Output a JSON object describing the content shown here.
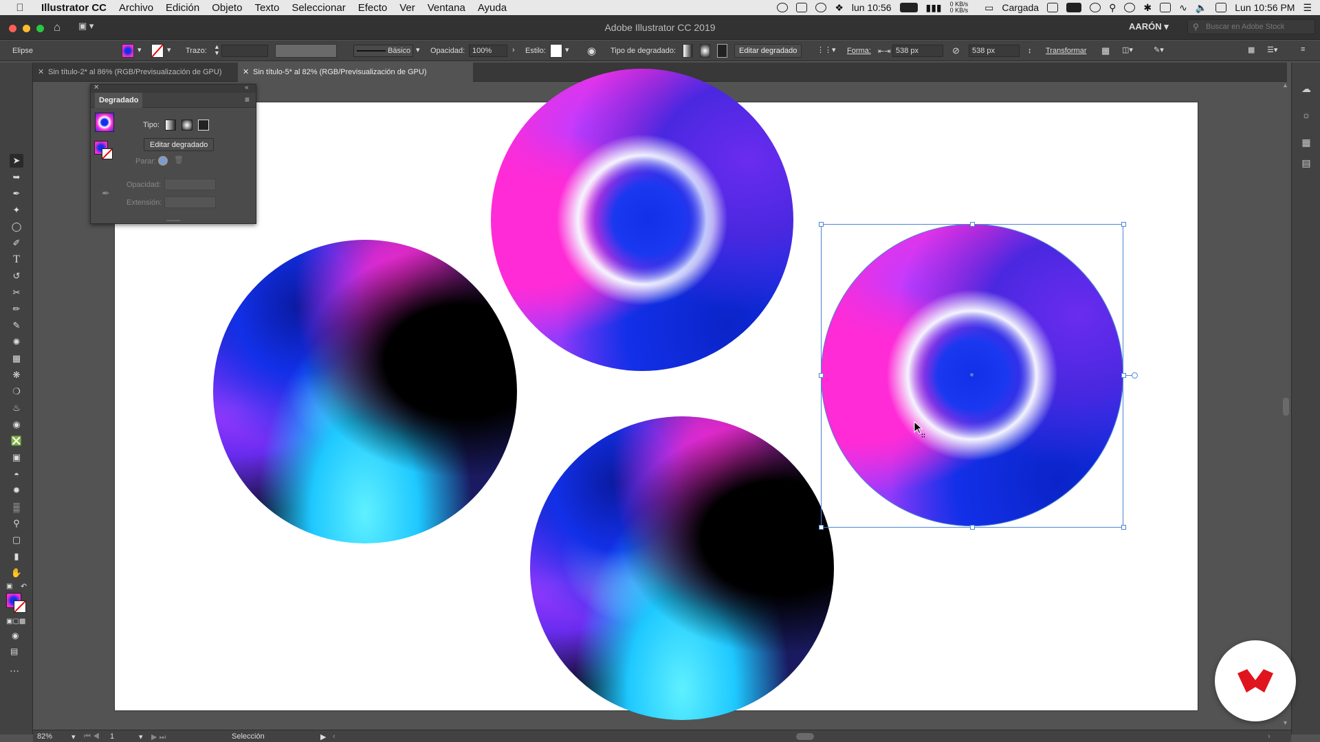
{
  "menubar": {
    "apple_icon": "apple-icon",
    "app_name": "Illustrator CC",
    "items": [
      "Archivo",
      "Edición",
      "Objeto",
      "Texto",
      "Seleccionar",
      "Efecto",
      "Ver",
      "Ventana",
      "Ayuda"
    ],
    "date_short": "lun 10:56",
    "net_up": "0 KB/s",
    "net_down": "0 KB/s",
    "battery": "Cargada",
    "clock": "Lun 10:56 PM"
  },
  "window": {
    "title": "Adobe Illustrator CC 2019",
    "user": "AARÓN",
    "stock_placeholder": "Buscar en Adobe Stock"
  },
  "control": {
    "object_type": "Elipse",
    "stroke_label": "Trazo:",
    "brush_label": "Básico",
    "opacity_label": "Opacidad:",
    "opacity_value": "100%",
    "style_label": "Estilo:",
    "gradient_type_label": "Tipo de degradado:",
    "edit_gradient": "Editar degradado",
    "shape_label": "Forma:",
    "width_value": "538 px",
    "height_value": "538 px",
    "transform": "Transformar"
  },
  "tabs": [
    {
      "label": "Sin título-2* al 86% (RGB/Previsualización de GPU)"
    },
    {
      "label": "Sin título-5* al 82% (RGB/Previsualización de GPU)"
    }
  ],
  "gradient_panel": {
    "title": "Degradado",
    "type_label": "Tipo:",
    "edit_button": "Editar degradado",
    "stop_label": "Parar:",
    "opacity_label": "Opacidad:",
    "extension_label": "Extensión:"
  },
  "status": {
    "zoom": "82%",
    "artboard": "1",
    "tool": "Selección"
  },
  "colors": {
    "magenta": "#ff2bd6",
    "blue": "#1230e8",
    "purple": "#8a2cf0",
    "cyan": "#5ff0ff",
    "brand_red": "#e0141c"
  }
}
